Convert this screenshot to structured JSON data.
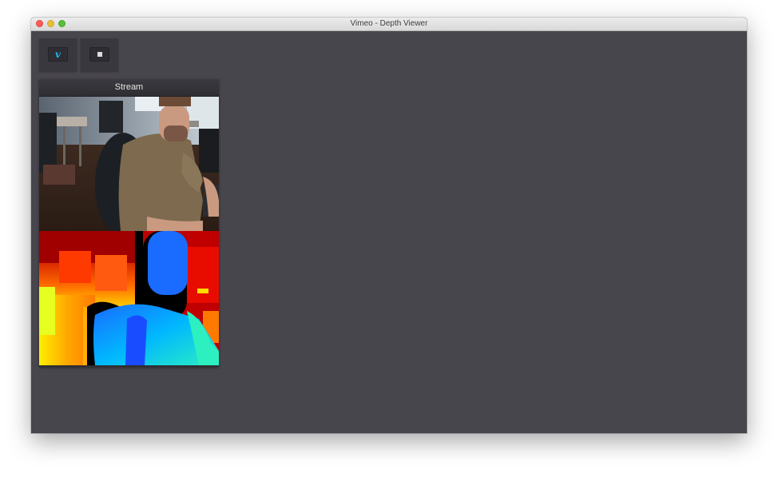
{
  "window": {
    "title": "Vimeo - Depth Viewer"
  },
  "toolbar": {
    "vimeo_button": {
      "icon": "vimeo-logo-icon",
      "glyph": "v",
      "color": "#1ab7ea"
    },
    "stop_button": {
      "icon": "stop-icon"
    }
  },
  "stream": {
    "label": "Stream",
    "feeds": [
      {
        "kind": "rgb-camera"
      },
      {
        "kind": "depth-map"
      }
    ]
  },
  "colors": {
    "window_bg": "#48464d",
    "panel_bg": "#2f2e33",
    "accent": "#1ab7ea"
  }
}
